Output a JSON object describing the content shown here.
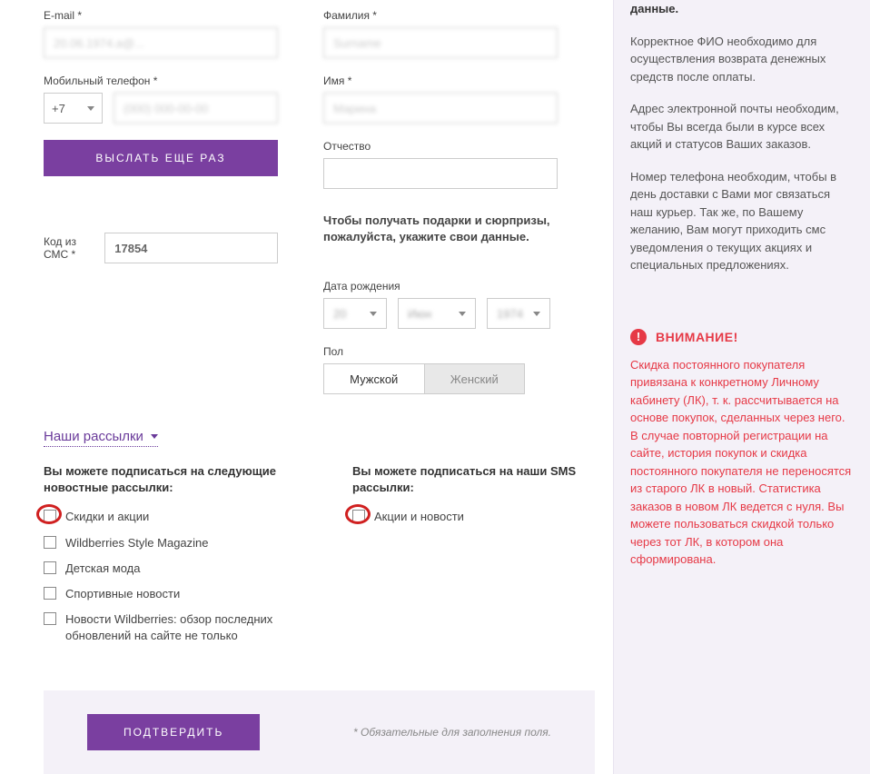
{
  "form": {
    "email": {
      "label": "E-mail *",
      "value": "20.06.1974.a@..."
    },
    "surname": {
      "label": "Фамилия *",
      "value": "Surname"
    },
    "phone": {
      "label": "Мобильный телефон *",
      "code": "+7",
      "value": "(000) 000-00-00"
    },
    "name": {
      "label": "Имя *",
      "value": "Марина"
    },
    "patronymic": {
      "label": "Отчество",
      "value": ""
    },
    "resend_button": "ВЫСЛАТЬ ЕЩЕ РАЗ",
    "sms": {
      "label": "Код из СМС *",
      "value": "17854"
    },
    "gifts_text": "Чтобы получать подарки и сюрпризы, пожалуйста, укажите свои данные.",
    "dob": {
      "label": "Дата рождения",
      "day": "20",
      "month": "Июн",
      "year": "1974"
    },
    "gender": {
      "label": "Пол",
      "male": "Мужской",
      "female": "Женский"
    }
  },
  "newsletters": {
    "header": "Наши рассылки",
    "news_heading": "Вы можете подписаться на следующие новостные рассылки:",
    "sms_heading": "Вы можете подписаться на наши SMS рассылки:",
    "items": [
      "Скидки и акции",
      "Wildberries Style Magazine",
      "Детская мода",
      "Спортивные новости",
      "Новости Wildberries: обзор последних обновлений на сайте не только"
    ],
    "sms_items": [
      "Акции и новости"
    ]
  },
  "footer": {
    "confirm": "ПОДТВЕРДИТЬ",
    "hint": "* Обязательные для заполнения поля."
  },
  "sidebar": {
    "top_bold": "данные.",
    "p1": "Корректное ФИО необходимо для осуществления возврата денежных средств после оплаты.",
    "p2": "Адрес электронной почты необходим, чтобы Вы всегда были в курсе всех акций и статусов Ваших заказов.",
    "p3": "Номер телефона необходим, чтобы в день доставки с Вами мог связаться наш курьер. Так же, по Вашему желанию, Вам могут приходить смс уведомления о текущих акциях и специальных предложениях.",
    "warn_title": "ВНИМАНИЕ!",
    "warn_text": "Скидка постоянного покупателя привязана к конкретному Личному кабинету (ЛК), т. к. рассчитывается на основе покупок, сделанных через него. В случае повторной регистрации на сайте, история покупок и скидка постоянного покупателя не переносятся из старого ЛК в новый. Статистика заказов в новом ЛК ведется с нуля. Вы можете пользоваться скидкой только через тот ЛК, в котором она сформирована."
  }
}
